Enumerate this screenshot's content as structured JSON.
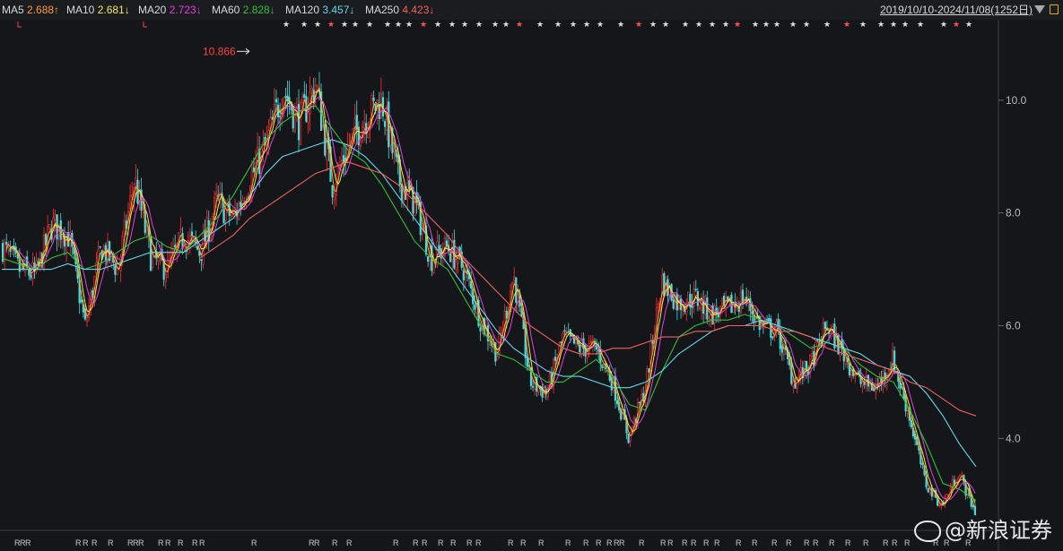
{
  "header": {
    "ma_items": [
      {
        "label": "MA5",
        "value": "2.688↑",
        "color": "#ff9a3c"
      },
      {
        "label": "MA10",
        "value": "2.681↓",
        "color": "#f2e84a"
      },
      {
        "label": "MA20",
        "value": "2.723↓",
        "color": "#e040e0"
      },
      {
        "label": "MA60",
        "value": "2.828↓",
        "color": "#33c033"
      },
      {
        "label": "MA120",
        "value": "3.457↓",
        "color": "#60d8e8"
      },
      {
        "label": "MA250",
        "value": "4.423↓",
        "color": "#f06060"
      }
    ],
    "date_range": "2019/10/10-2024/11/08(1252日)",
    "dropdown_icon": "triangle-down-icon",
    "lock_icon": "lock-icon"
  },
  "watermark": {
    "text": "@新浪证券",
    "icon": "weibo-icon"
  },
  "chart_data": {
    "type": "candlestick-line",
    "y_axis": {
      "ticks": [
        4.0,
        6.0,
        8.0,
        10.0
      ],
      "tick_labels": [
        "4.0",
        "6.0",
        "8.0",
        "10.0"
      ],
      "ylim": [
        2.4,
        11.3
      ]
    },
    "annotation": {
      "text": "10.866",
      "value": 10.866
    },
    "price_close_approx": [
      7.4,
      7.0,
      6.9,
      7.8,
      7.6,
      6.0,
      7.4,
      7.0,
      8.6,
      7.2,
      7.0,
      7.6,
      7.3,
      8.2,
      7.9,
      8.6,
      9.2,
      10.2,
      9.6,
      10.3,
      8.5,
      9.2,
      9.7,
      10.0,
      8.6,
      8.2,
      7.2,
      7.4,
      7.0,
      6.1,
      5.5,
      6.9,
      5.0,
      4.8,
      5.8,
      5.6,
      5.6,
      5.0,
      4.0,
      4.9,
      6.8,
      6.4,
      6.5,
      6.2,
      6.3,
      6.5,
      6.0,
      5.9,
      5.0,
      5.3,
      6.0,
      5.5,
      5.0,
      4.9,
      5.4,
      4.4,
      3.2,
      2.8,
      3.4,
      2.7
    ],
    "series": [
      {
        "name": "MA60",
        "color": "#33c033",
        "values": [
          7.2,
          7.1,
          7.0,
          7.2,
          7.3,
          7.0,
          7.1,
          7.3,
          7.5,
          7.6,
          7.4,
          7.3,
          7.6,
          7.9,
          8.3,
          8.8,
          9.3,
          9.6,
          9.8,
          9.9,
          9.5,
          9.1,
          8.9,
          8.5,
          8.0,
          7.5,
          7.2,
          7.0,
          6.5,
          6.0,
          5.5,
          5.4,
          5.2,
          5.0,
          5.0,
          5.2,
          5.4,
          5.1,
          4.6,
          4.5,
          5.2,
          5.8,
          6.0,
          6.1,
          6.1,
          6.2,
          6.1,
          6.0,
          5.8,
          5.6,
          5.7,
          5.6,
          5.3,
          5.1,
          5.0,
          4.5,
          3.9,
          3.2,
          3.1,
          2.9
        ]
      },
      {
        "name": "MA120",
        "color": "#60d8e8",
        "values": [
          7.0,
          7.0,
          7.0,
          7.0,
          7.1,
          7.0,
          7.0,
          7.1,
          7.2,
          7.3,
          7.3,
          7.3,
          7.5,
          7.7,
          7.9,
          8.3,
          8.7,
          9.0,
          9.1,
          9.2,
          9.3,
          9.2,
          9.0,
          8.7,
          8.3,
          7.9,
          7.5,
          7.1,
          6.7,
          6.3,
          5.9,
          5.6,
          5.4,
          5.2,
          5.1,
          5.1,
          5.0,
          4.9,
          4.9,
          5.0,
          5.2,
          5.5,
          5.7,
          5.9,
          6.0,
          6.0,
          6.1,
          6.0,
          5.9,
          5.8,
          5.7,
          5.6,
          5.5,
          5.3,
          5.2,
          5.1,
          4.8,
          4.4,
          3.9,
          3.5
        ]
      },
      {
        "name": "MA250",
        "color": "#f06060",
        "values": [
          null,
          null,
          null,
          null,
          null,
          null,
          null,
          null,
          null,
          null,
          null,
          null,
          7.2,
          7.4,
          7.6,
          7.9,
          8.1,
          8.3,
          8.5,
          8.7,
          8.8,
          8.9,
          8.8,
          8.7,
          8.5,
          8.2,
          7.9,
          7.6,
          7.2,
          6.9,
          6.6,
          6.3,
          6.0,
          5.8,
          5.6,
          5.5,
          5.5,
          5.6,
          5.6,
          5.7,
          5.8,
          5.8,
          5.9,
          5.9,
          6.0,
          6.0,
          6.0,
          5.9,
          5.9,
          5.8,
          5.6,
          5.5,
          5.4,
          5.3,
          5.2,
          5.0,
          4.9,
          4.7,
          4.5,
          4.4
        ]
      }
    ],
    "top_markers": "★",
    "bottom_markers": "R"
  }
}
